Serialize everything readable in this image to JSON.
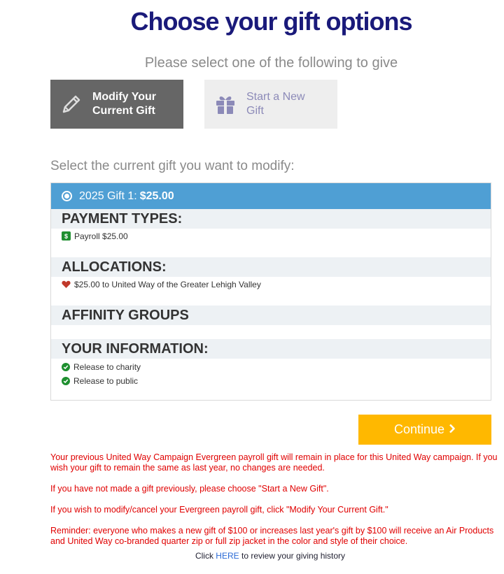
{
  "page": {
    "title": "Choose your gift options",
    "subtitle": "Please select one of the following to give"
  },
  "options": {
    "modify": {
      "label_line1": "Modify Your",
      "label_line2": "Current Gift",
      "icon": "pencil-icon"
    },
    "new": {
      "label_line1": "Start a New",
      "label_line2": "Gift",
      "icon": "gift-icon"
    }
  },
  "select_label": "Select the current gift you want to modify:",
  "gift": {
    "name": "2025 Gift 1:",
    "amount": "$25.00",
    "sections": {
      "payment_types": {
        "heading": "PAYMENT TYPES:",
        "items": [
          {
            "icon": "dollar-icon",
            "badge": "$",
            "text": "Payroll $25.00"
          }
        ]
      },
      "allocations": {
        "heading": "ALLOCATIONS:",
        "items": [
          {
            "icon": "heart-icon",
            "text": "$25.00 to United Way of the Greater Lehigh Valley"
          }
        ]
      },
      "affinity_groups": {
        "heading": "AFFINITY GROUPS",
        "items": []
      },
      "your_information": {
        "heading": "YOUR INFORMATION:",
        "items": [
          {
            "icon": "check-circle-icon",
            "text": "Release to charity"
          },
          {
            "icon": "check-circle-icon",
            "text": "Release to public"
          }
        ]
      }
    }
  },
  "continue_label": "Continue",
  "notes": [
    "Your previous United Way Campaign Evergreen payroll gift will remain in place for this United Way campaign. If you wish your gift to remain the same as last year, no changes are needed.",
    "If you have not made a gift previously, please choose \"Start a New Gift\".",
    "If you wish to modify/cancel your Evergreen payroll gift, click \"Modify Your Current Gift.\"",
    "Reminder: everyone who makes a new gift of $100 or increases last year's gift by $100 will receive an Air Products and United Way co-branded quarter zip or full zip jacket in the color and style of their choice."
  ],
  "history": {
    "prefix": "Click",
    "link": "HERE",
    "suffix": "to review your giving history"
  },
  "colors": {
    "title": "#1a1a7a",
    "gift_header": "#4f9fd4",
    "continue": "#ffb800",
    "notes": "#e00000",
    "check": "#1e8f2f",
    "heart": "#c0392b"
  }
}
